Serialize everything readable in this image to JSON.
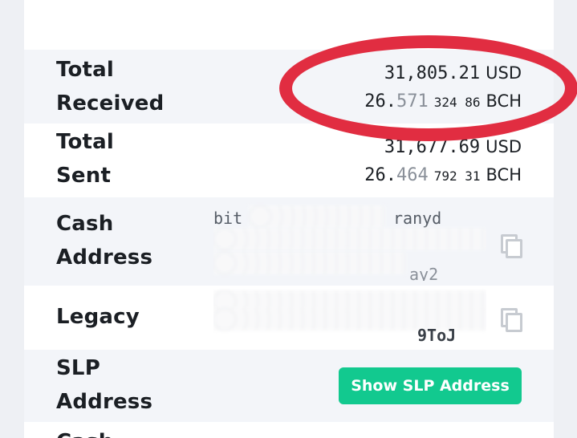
{
  "rows": {
    "total_received": {
      "label_line1": "Total",
      "label_line2": "Received",
      "fiat_value": "31,805.21",
      "fiat_unit": "USD",
      "bch_int": "26.",
      "bch_dec1": "571",
      "bch_dec2": "324 86",
      "bch_unit": "BCH"
    },
    "total_sent": {
      "label_line1": "Total",
      "label_line2": "Sent",
      "fiat_value": "31,677.69",
      "fiat_unit": "USD",
      "bch_int": "26.",
      "bch_dec1": "464",
      "bch_dec2": "792 31",
      "bch_unit": "BCH"
    },
    "cash_address": {
      "label_line1": "Cash",
      "label_line2": "Address",
      "visible_start": "bit",
      "visible_mid": "ranyd",
      "visible_end": "ay2",
      "copy_icon": "copy-icon"
    },
    "legacy": {
      "label": "Legacy",
      "visible_end": "9ToJ",
      "copy_icon": "copy-icon"
    },
    "slp_address": {
      "label_line1": "SLP",
      "label_line2": "Address",
      "button_label": "Show SLP Address"
    },
    "next": {
      "label_line1": "Cash"
    }
  },
  "colors": {
    "accent_button": "#12c98f",
    "annotation": "#e12d41",
    "row_alt": "#f3f5f9"
  }
}
